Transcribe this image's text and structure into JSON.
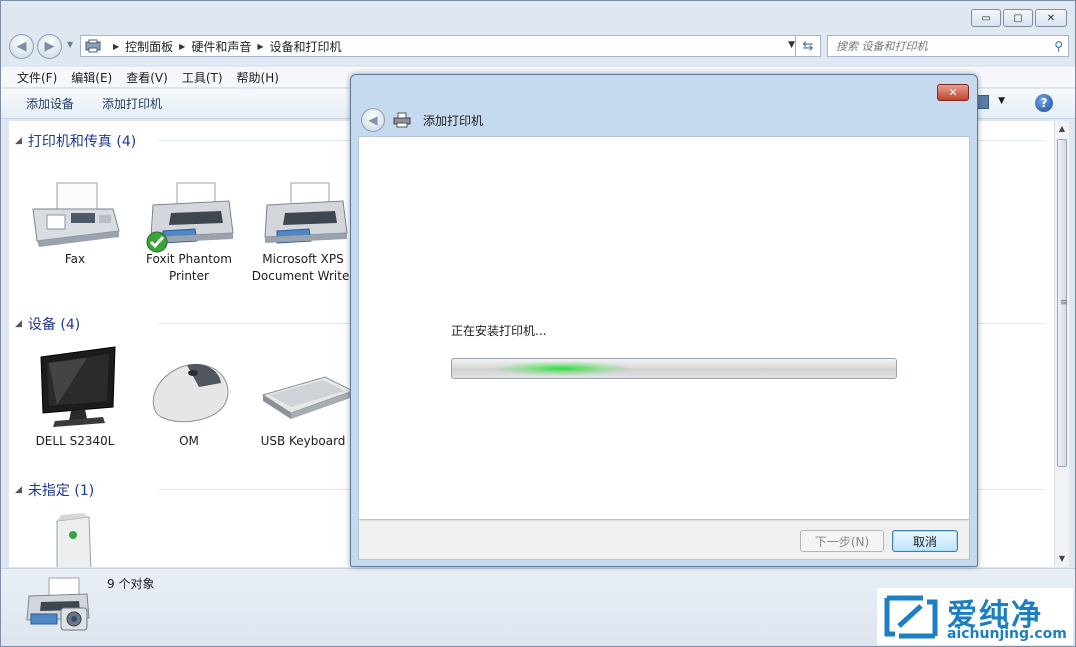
{
  "window": {
    "caption_buttons": {
      "minimize": "▭",
      "maximize": "▢",
      "close": "✕"
    }
  },
  "address": {
    "breadcrumbs": [
      "控制面板",
      "硬件和声音",
      "设备和打印机"
    ],
    "search_placeholder": "搜索 设备和打印机"
  },
  "menubar": {
    "items": [
      "文件(F)",
      "编辑(E)",
      "查看(V)",
      "工具(T)",
      "帮助(H)"
    ]
  },
  "commandbar": {
    "items": [
      "添加设备",
      "添加打印机"
    ],
    "help": "?"
  },
  "groups": [
    {
      "header": "打印机和传真 (4)",
      "devices": [
        {
          "label": "Fax",
          "icon": "fax-icon"
        },
        {
          "label": "Foxit Phantom Printer",
          "icon": "printer-icon",
          "default": true
        },
        {
          "label": "Microsoft XPS Document Writer",
          "icon": "printer-icon"
        }
      ]
    },
    {
      "header": "设备 (4)",
      "devices": [
        {
          "label": "DELL S2340L",
          "icon": "monitor-icon"
        },
        {
          "label": "OM",
          "icon": "mouse-icon"
        },
        {
          "label": "USB Keyboard",
          "icon": "keyboard-icon"
        }
      ]
    },
    {
      "header": "未指定 (1)",
      "devices": [
        {
          "label": "",
          "icon": "tower-pc-icon"
        }
      ]
    }
  ],
  "statusbar": {
    "text": "9 个对象"
  },
  "dialog": {
    "title": "添加打印机",
    "close": "✕",
    "status": "正在安装打印机...",
    "progress_state": "indeterminate",
    "buttons": {
      "next": "下一步(N)",
      "cancel": "取消"
    }
  },
  "watermark": {
    "cn": "爱纯净",
    "en": "aichunjing.com"
  },
  "colors": {
    "group_header": "#1e3a8a",
    "progress_glow": "#28dc3c",
    "watermark": "#1b7fc2"
  }
}
